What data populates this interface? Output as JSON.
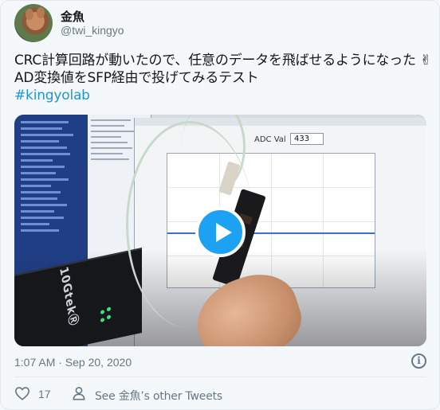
{
  "author": {
    "display_name": "金魚",
    "handle": "@twi_kingyo",
    "avatar": "squirrel-avatar"
  },
  "tweet": {
    "line1": "CRC計算回路が動いたので、任意のデータを飛ばせるようになった ✌",
    "line2": "AD変換値をSFP経由で投げてみるテスト",
    "hashtag": "#kingyolab"
  },
  "media": {
    "type": "video",
    "play_icon": "play-icon",
    "screen": {
      "adc_label": "ADC Val",
      "adc_value": "433"
    },
    "device_brand": "10GtekⓇ"
  },
  "meta": {
    "timestamp": "1:07 AM · Sep 20, 2020",
    "info_icon": "info-icon"
  },
  "actions": {
    "like_icon": "heart-icon",
    "like_count": "17",
    "see_others": "See 金魚’s other Tweets",
    "person_icon": "person-icon"
  },
  "colors": {
    "link": "#1b95e0",
    "play_button": "#1da1f2",
    "secondary_text": "#657786",
    "background": "#f5f8fa"
  }
}
